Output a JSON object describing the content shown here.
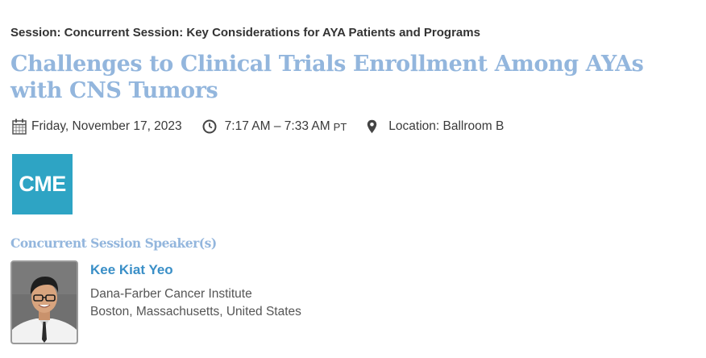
{
  "session": {
    "label": "Session: Concurrent Session: Key Considerations for AYA Patients and Programs"
  },
  "title": "Challenges to Clinical Trials Enrollment Among AYAs with CNS Tumors",
  "meta": {
    "date": "Friday, November 17, 2023",
    "date_icon": "calendar-icon",
    "time": "7:17 AM – 7:33 AM",
    "timezone": "PT",
    "time_icon": "clock-icon",
    "location": "Location: Ballroom B",
    "location_icon": "map-pin-icon"
  },
  "badge": {
    "text": "CME",
    "color": "#2ea4c4"
  },
  "speakers": {
    "heading": "Concurrent Session Speaker(s)",
    "items": [
      {
        "name": "Kee Kiat Yeo",
        "organization": "Dana-Farber Cancer Institute",
        "location": "Boston, Massachusetts, United States"
      }
    ]
  },
  "colors": {
    "title": "#93b6dd",
    "speaker_name": "#3a8fc7",
    "text": "#333333"
  }
}
